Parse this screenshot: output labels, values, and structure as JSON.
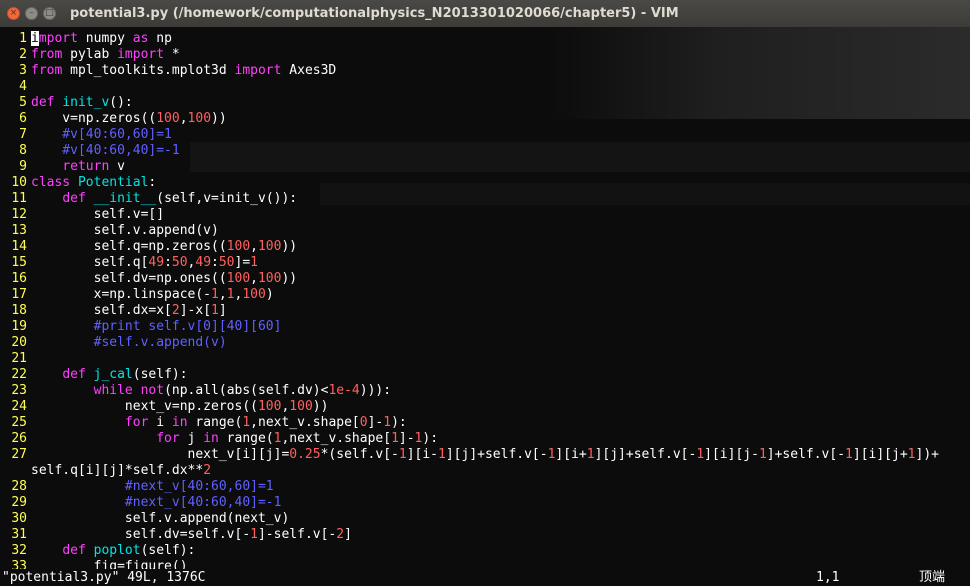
{
  "window": {
    "title": "potential3.py (/homework/computationalphysics_N2013301020066/chapter5) - VIM"
  },
  "editor": {
    "lines": [
      {
        "n": "1",
        "tokens": [
          [
            "cursor",
            "i"
          ],
          [
            "kw",
            "mport"
          ],
          [
            "t",
            " numpy "
          ],
          [
            "kw",
            "as"
          ],
          [
            "t",
            " np"
          ]
        ]
      },
      {
        "n": "2",
        "tokens": [
          [
            "kw",
            "from"
          ],
          [
            "t",
            " pylab "
          ],
          [
            "kw",
            "import"
          ],
          [
            "t",
            " *"
          ]
        ]
      },
      {
        "n": "3",
        "tokens": [
          [
            "kw",
            "from"
          ],
          [
            "t",
            " mpl_toolkits.mplot3d "
          ],
          [
            "kw",
            "import"
          ],
          [
            "t",
            " Axes3D"
          ]
        ]
      },
      {
        "n": "4",
        "tokens": []
      },
      {
        "n": "5",
        "tokens": [
          [
            "kw",
            "def"
          ],
          [
            "t",
            " "
          ],
          [
            "fn",
            "init_v"
          ],
          [
            "t",
            "():"
          ]
        ]
      },
      {
        "n": "6",
        "tokens": [
          [
            "t",
            "    v=np.zeros(("
          ],
          [
            "num",
            "100"
          ],
          [
            "t",
            ","
          ],
          [
            "num",
            "100"
          ],
          [
            "t",
            "))"
          ]
        ]
      },
      {
        "n": "7",
        "tokens": [
          [
            "cmt",
            "    #v[40:60,60]=1"
          ]
        ]
      },
      {
        "n": "8",
        "tokens": [
          [
            "cmt",
            "    #v[40:60,40]=-1"
          ]
        ]
      },
      {
        "n": "9",
        "tokens": [
          [
            "t",
            "    "
          ],
          [
            "kw",
            "return"
          ],
          [
            "t",
            " v"
          ]
        ]
      },
      {
        "n": "10",
        "tokens": [
          [
            "kw",
            "class"
          ],
          [
            "t",
            " "
          ],
          [
            "fn",
            "Potential"
          ],
          [
            "t",
            ":"
          ]
        ]
      },
      {
        "n": "11",
        "tokens": [
          [
            "t",
            "    "
          ],
          [
            "kw",
            "def"
          ],
          [
            "t",
            " "
          ],
          [
            "fn",
            "__init__"
          ],
          [
            "t",
            "(self,v=init_v()):"
          ]
        ]
      },
      {
        "n": "12",
        "tokens": [
          [
            "t",
            "        self.v=[]"
          ]
        ]
      },
      {
        "n": "13",
        "tokens": [
          [
            "t",
            "        self.v.append(v)"
          ]
        ]
      },
      {
        "n": "14",
        "tokens": [
          [
            "t",
            "        self.q=np.zeros(("
          ],
          [
            "num",
            "100"
          ],
          [
            "t",
            ","
          ],
          [
            "num",
            "100"
          ],
          [
            "t",
            "))"
          ]
        ]
      },
      {
        "n": "15",
        "tokens": [
          [
            "t",
            "        self.q["
          ],
          [
            "num",
            "49"
          ],
          [
            "t",
            ":"
          ],
          [
            "num",
            "50"
          ],
          [
            "t",
            ","
          ],
          [
            "num",
            "49"
          ],
          [
            "t",
            ":"
          ],
          [
            "num",
            "50"
          ],
          [
            "t",
            "]="
          ],
          [
            "num",
            "1"
          ]
        ]
      },
      {
        "n": "16",
        "tokens": [
          [
            "t",
            "        self.dv=np.ones(("
          ],
          [
            "num",
            "100"
          ],
          [
            "t",
            ","
          ],
          [
            "num",
            "100"
          ],
          [
            "t",
            "))"
          ]
        ]
      },
      {
        "n": "17",
        "tokens": [
          [
            "t",
            "        x=np.linspace(-"
          ],
          [
            "num",
            "1"
          ],
          [
            "t",
            ","
          ],
          [
            "num",
            "1"
          ],
          [
            "t",
            ","
          ],
          [
            "num",
            "100"
          ],
          [
            "t",
            ")"
          ]
        ]
      },
      {
        "n": "18",
        "tokens": [
          [
            "t",
            "        self.dx=x["
          ],
          [
            "num",
            "2"
          ],
          [
            "t",
            "]-x["
          ],
          [
            "num",
            "1"
          ],
          [
            "t",
            "]"
          ]
        ]
      },
      {
        "n": "19",
        "tokens": [
          [
            "cmt",
            "        #print self.v[0][40][60]"
          ]
        ]
      },
      {
        "n": "20",
        "tokens": [
          [
            "cmt",
            "        #self.v.append(v)"
          ]
        ]
      },
      {
        "n": "21",
        "tokens": []
      },
      {
        "n": "22",
        "tokens": [
          [
            "t",
            "    "
          ],
          [
            "kw",
            "def"
          ],
          [
            "t",
            " "
          ],
          [
            "fn",
            "j_cal"
          ],
          [
            "t",
            "(self):"
          ]
        ]
      },
      {
        "n": "23",
        "tokens": [
          [
            "t",
            "        "
          ],
          [
            "kw",
            "while"
          ],
          [
            "t",
            " "
          ],
          [
            "kw",
            "not"
          ],
          [
            "t",
            "(np.all(abs(self.dv)<"
          ],
          [
            "num",
            "1e-4"
          ],
          [
            "t",
            "))):"
          ]
        ]
      },
      {
        "n": "24",
        "tokens": [
          [
            "t",
            "            next_v=np.zeros(("
          ],
          [
            "num",
            "100"
          ],
          [
            "t",
            ","
          ],
          [
            "num",
            "100"
          ],
          [
            "t",
            "))"
          ]
        ]
      },
      {
        "n": "25",
        "tokens": [
          [
            "t",
            "            "
          ],
          [
            "kw",
            "for"
          ],
          [
            "t",
            " i "
          ],
          [
            "kw",
            "in"
          ],
          [
            "t",
            " range("
          ],
          [
            "num",
            "1"
          ],
          [
            "t",
            ",next_v.shape["
          ],
          [
            "num",
            "0"
          ],
          [
            "t",
            "]-"
          ],
          [
            "num",
            "1"
          ],
          [
            "t",
            "):"
          ]
        ]
      },
      {
        "n": "26",
        "tokens": [
          [
            "t",
            "                "
          ],
          [
            "kw",
            "for"
          ],
          [
            "t",
            " j "
          ],
          [
            "kw",
            "in"
          ],
          [
            "t",
            " range("
          ],
          [
            "num",
            "1"
          ],
          [
            "t",
            ",next_v.shape["
          ],
          [
            "num",
            "1"
          ],
          [
            "t",
            "]-"
          ],
          [
            "num",
            "1"
          ],
          [
            "t",
            "):"
          ]
        ]
      },
      {
        "n": "27",
        "tokens": [
          [
            "t",
            "                    next_v[i][j]="
          ],
          [
            "num",
            "0.25"
          ],
          [
            "t",
            "*(self.v[-"
          ],
          [
            "num",
            "1"
          ],
          [
            "t",
            "][i-"
          ],
          [
            "num",
            "1"
          ],
          [
            "t",
            "][j]+self.v[-"
          ],
          [
            "num",
            "1"
          ],
          [
            "t",
            "][i+"
          ],
          [
            "num",
            "1"
          ],
          [
            "t",
            "][j]+self.v[-"
          ],
          [
            "num",
            "1"
          ],
          [
            "t",
            "][i][j-"
          ],
          [
            "num",
            "1"
          ],
          [
            "t",
            "]+self.v[-"
          ],
          [
            "num",
            "1"
          ],
          [
            "t",
            "][i][j+"
          ],
          [
            "num",
            "1"
          ],
          [
            "t",
            "])+"
          ]
        ]
      },
      {
        "n": "",
        "tokens": [
          [
            "t",
            "self.q[i][j]*self.dx**"
          ],
          [
            "num",
            "2"
          ]
        ]
      },
      {
        "n": "28",
        "tokens": [
          [
            "cmt",
            "            #next_v[40:60,60]=1"
          ]
        ]
      },
      {
        "n": "29",
        "tokens": [
          [
            "cmt",
            "            #next_v[40:60,40]=-1"
          ]
        ]
      },
      {
        "n": "30",
        "tokens": [
          [
            "t",
            "            self.v.append(next_v)"
          ]
        ]
      },
      {
        "n": "31",
        "tokens": [
          [
            "t",
            "            self.dv=self.v[-"
          ],
          [
            "num",
            "1"
          ],
          [
            "t",
            "]-self.v[-"
          ],
          [
            "num",
            "2"
          ],
          [
            "t",
            "]"
          ]
        ]
      },
      {
        "n": "32",
        "tokens": [
          [
            "t",
            "    "
          ],
          [
            "kw",
            "def"
          ],
          [
            "t",
            " "
          ],
          [
            "fn",
            "poplot"
          ],
          [
            "t",
            "(self):"
          ]
        ]
      },
      {
        "n": "33",
        "tokens": [
          [
            "t",
            "        fig=figure()"
          ]
        ]
      }
    ]
  },
  "statusline": {
    "file_info": "\"potential3.py\" 49L, 1376C",
    "cursor_position": "1,1",
    "scroll_position": "顶端"
  },
  "colors": {
    "line_number": "#ffff55",
    "keyword": "#ff40ff",
    "number": "#ff6060",
    "comment": "#6060ff",
    "function_name": "#00e5e5",
    "text": "#ffffff",
    "background": "#0c0c0c"
  }
}
